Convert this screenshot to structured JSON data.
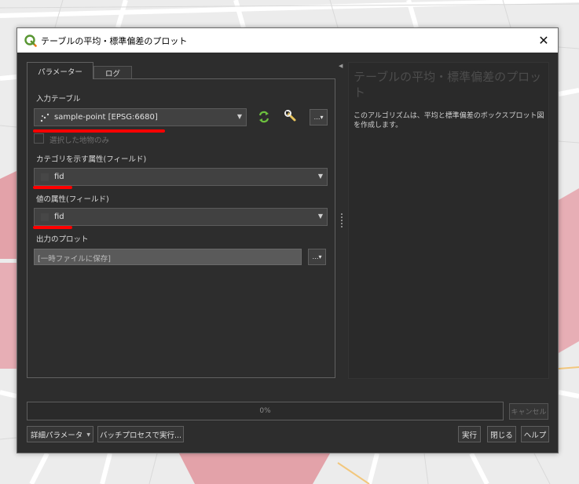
{
  "window": {
    "title": "テーブルの平均・標準偏差のプロット",
    "close_glyph": "✕"
  },
  "tabs": [
    {
      "label": "パラメーター",
      "active": true
    },
    {
      "label": "ログ",
      "active": false
    }
  ],
  "params": {
    "input_table_label": "入力テーブル",
    "input_table_value": "sample-point [EPSG:6680]",
    "selected_only_label": "選択した地物のみ",
    "category_label": "カテゴリを示す属性(フィールド)",
    "category_value": "fid",
    "value_label": "値の属性(フィールド)",
    "value_value": "fid",
    "output_label": "出力のプロット",
    "output_value": "[一時ファイルに保存]",
    "dots_label": "…▾"
  },
  "help": {
    "title": "テーブルの平均・標準偏差のプロット",
    "description": "このアルゴリズムは、平均と標準偏差のボックスプロット図を作成します。"
  },
  "progress": {
    "text": "0%",
    "value": 0
  },
  "buttons": {
    "cancel": "キャンセル",
    "advanced": "詳細パラメータ",
    "batch": "バッチプロセスで実行...",
    "run": "実行",
    "close": "閉じる",
    "help": "ヘルプ"
  },
  "icons": {
    "title": "qgis-logo-icon",
    "layer": "point-layer-icon",
    "iterate": "iterate-icon",
    "settings": "wrench-icon",
    "field": "field-icon"
  },
  "colors": {
    "dialog_bg": "#2d2d2d",
    "annotation_red": "#ff0000",
    "map_highlight": "#e8a0a8",
    "qgis_green": "#589632"
  }
}
